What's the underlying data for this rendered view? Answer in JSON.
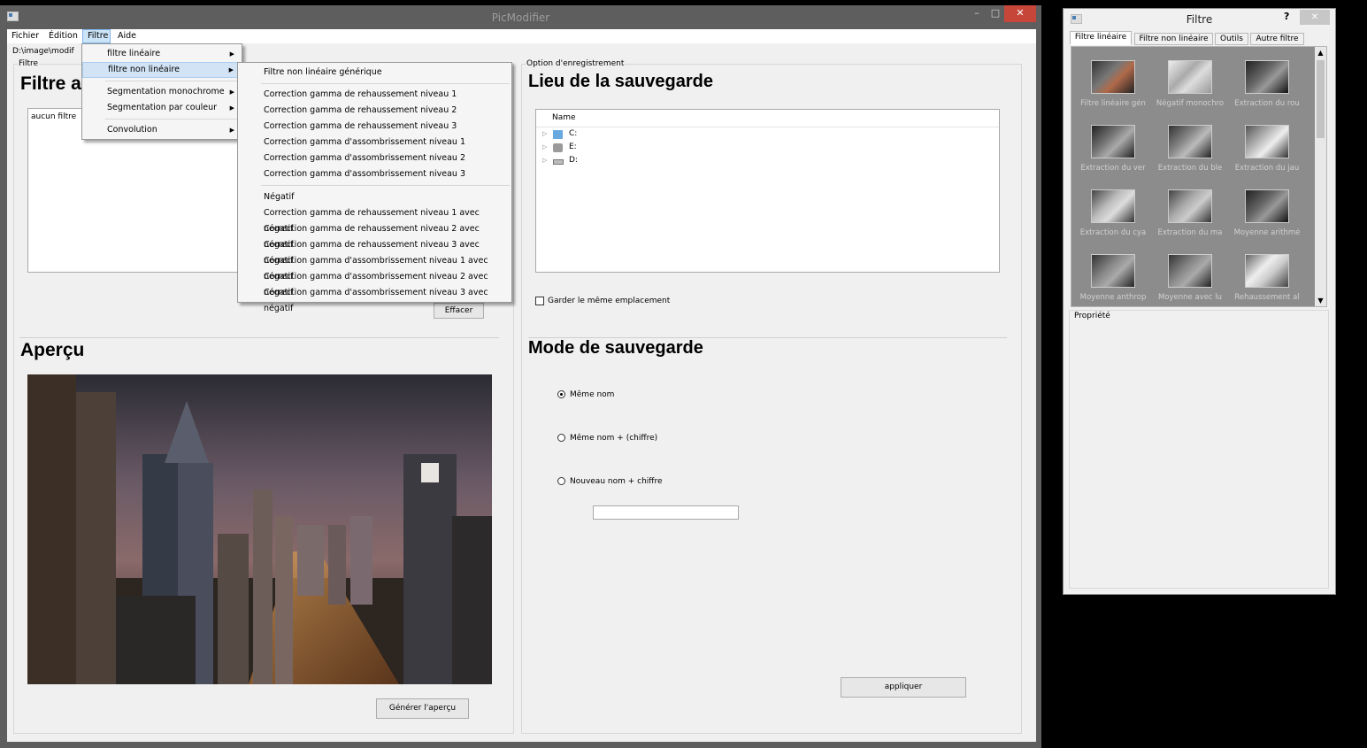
{
  "main_window": {
    "title": "PicModifier",
    "minimize_label": "–",
    "maximize_label": "□",
    "close_label": "✕"
  },
  "menubar": {
    "items": [
      "Fichier",
      "Édition",
      "Filtre",
      "Aide"
    ]
  },
  "path_text": "D:\\image\\modif",
  "filter_group": {
    "label": "Filtre",
    "heading": "Filtre a",
    "list_item": "aucun filtre",
    "clear_button": "Effacer"
  },
  "filtre_menu": {
    "items": [
      "filtre linéaire",
      "filtre non linéaire",
      "Segmentation monochrome",
      "Segmentation par couleur",
      "Convolution"
    ]
  },
  "nonlinear_submenu": {
    "items": [
      "Filtre non linéaire générique",
      "Correction gamma de rehaussement niveau 1",
      "Correction gamma de rehaussement niveau 2",
      "Correction gamma de rehaussement niveau 3",
      "Correction gamma d'assombrissement niveau 1",
      "Correction gamma d'assombrissement niveau 2",
      "Correction gamma d'assombrissement niveau 3",
      "Négatif",
      "Correction gamma de rehaussement niveau 1 avec négatif",
      "Correction gamma de rehaussement niveau 2 avec négatif",
      "Correction gamma de rehaussement niveau 3 avec négatif",
      "Correction gamma d'assombrissement niveau 1 avec négatif",
      "Correction gamma d'assombrissement niveau 2 avec négatif",
      "Correction gamma d'assombrissement niveau 3 avec négatif"
    ]
  },
  "preview": {
    "heading": "Aperçu",
    "generate_button": "Générer l'aperçu"
  },
  "save_options": {
    "group_label": "Option d'enregistrement",
    "location_heading": "Lieu de la sauvegarde",
    "tree_header": "Name",
    "drives": [
      "C:",
      "E:",
      "D:"
    ],
    "keep_location_label": "Garder le même emplacement",
    "mode_heading": "Mode de sauvegarde",
    "radio_options": [
      "Même nom",
      "Même nom + (chiffre)",
      "Nouveau nom + chiffre"
    ],
    "selected_radio": "Même nom",
    "new_name_value": "",
    "apply_button": "appliquer"
  },
  "filter_window": {
    "title": "Filtre",
    "help_label": "?",
    "close_label": "✕",
    "tabs": [
      "Filtre linéaire",
      "Filtre non linéaire",
      "Outils",
      "Autre filtre"
    ],
    "selected_tab": "Filtre linéaire",
    "thumbnails": [
      "Filtre linéaire gén",
      "Négatif monochro",
      "Extraction du rou",
      "Extraction du ver",
      "Extraction du ble",
      "Extraction du jau",
      "Extraction du cya",
      "Extraction du ma",
      "Moyenne arithmé",
      "Moyenne anthrop",
      "Moyenne avec lu",
      "Rehaussement al"
    ],
    "properties_label": "Propriété"
  }
}
